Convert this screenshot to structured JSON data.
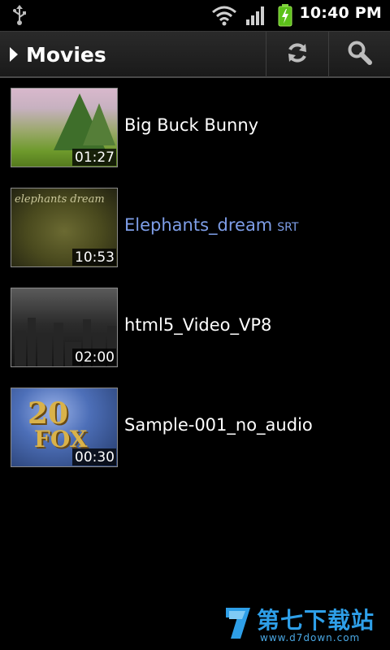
{
  "status_bar": {
    "time": "10:40 PM",
    "icons": [
      "usb-icon",
      "wifi-icon",
      "signal-icon",
      "battery-charging-icon"
    ]
  },
  "action_bar": {
    "title": "Movies",
    "buttons": [
      "refresh-icon",
      "search-icon"
    ]
  },
  "videos": [
    {
      "title": "Big Buck Bunny",
      "duration": "01:27",
      "subtitle": ""
    },
    {
      "title": "Elephants_dream",
      "duration": "10:53",
      "subtitle": "SRT"
    },
    {
      "title": "html5_Video_VP8",
      "duration": "02:00",
      "subtitle": ""
    },
    {
      "title": "Sample-001_no_audio",
      "duration": "00:30",
      "subtitle": ""
    }
  ],
  "thumbnail_text": {
    "elephants": "elephants dream",
    "fox_top": "20",
    "fox_bottom": "FOX"
  },
  "watermark": {
    "name": "第七下载站",
    "url": "www.d7down.com"
  },
  "colors": {
    "highlight": "#7e9ee8",
    "watermark": "#2e9fe8"
  }
}
